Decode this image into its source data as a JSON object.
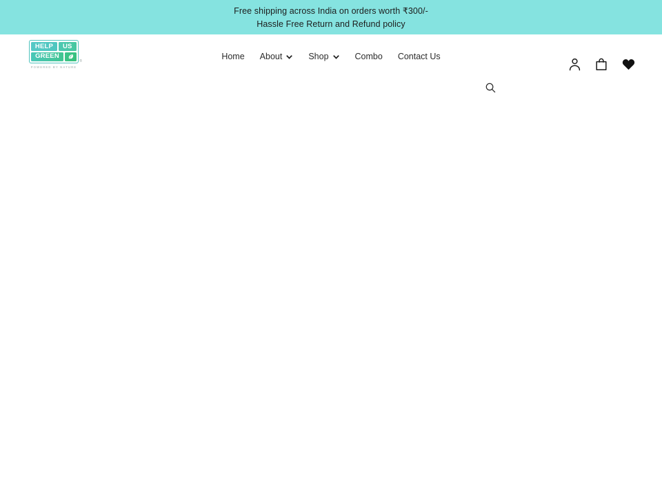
{
  "announcement": {
    "background_color": "#85e3e0",
    "lines": [
      "Free shipping across India on orders worth ₹300/-",
      "Hassle Free Return and Refund policy"
    ]
  },
  "header": {
    "logo": {
      "word_1": "HELP",
      "word_2": "US",
      "word_3": "GREEN",
      "leaf_icon": "leaf-icon",
      "registered_mark": "®",
      "tagline": "POWERED BY NATURE",
      "brand_color": "#4ec6bf",
      "accent_color": "#35bf79"
    },
    "nav": [
      {
        "label": "Home",
        "has_dropdown": false
      },
      {
        "label": "About",
        "has_dropdown": true,
        "dropdown_icon": "chevron-down-icon"
      },
      {
        "label": "Shop",
        "has_dropdown": true,
        "dropdown_icon": "chevron-down-icon"
      },
      {
        "label": "Combo",
        "has_dropdown": false
      },
      {
        "label": "Contact Us",
        "has_dropdown": false
      }
    ],
    "search": {
      "icon": "search-icon",
      "label": "Search"
    },
    "icons": [
      {
        "name": "account-icon",
        "label": "Log in"
      },
      {
        "name": "cart-icon",
        "label": "Cart"
      },
      {
        "name": "wishlist-icon",
        "label": "Wishlist"
      }
    ]
  },
  "main": {
    "content": ""
  }
}
